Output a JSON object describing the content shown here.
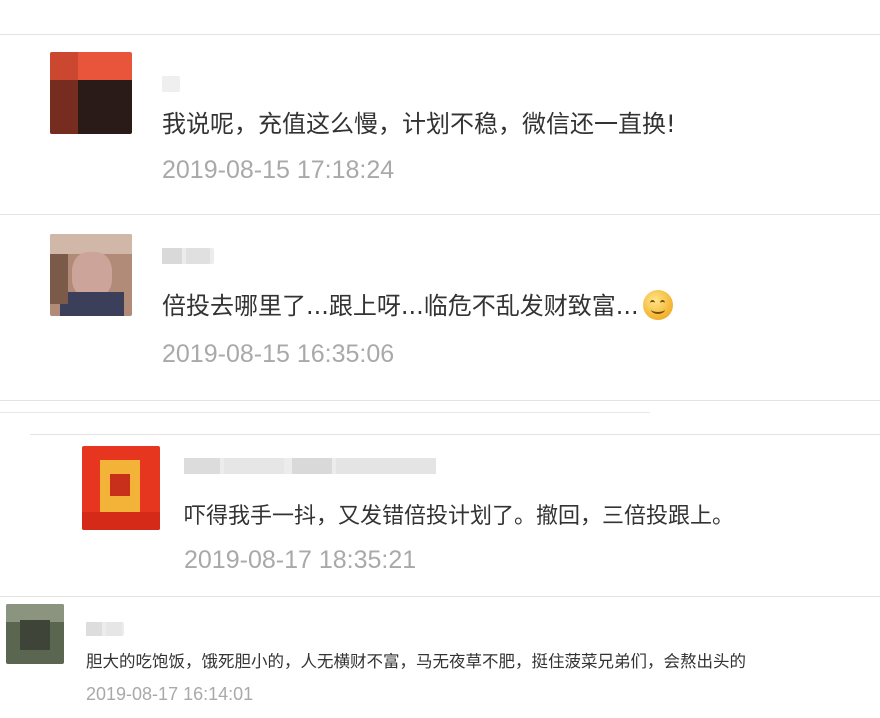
{
  "comments": [
    {
      "text": "我说呢，充值这么慢，计划不稳，微信还一直换!",
      "time": "2019-08-15 17:18:24"
    },
    {
      "text": "倍投去哪里了...跟上呀...临危不乱发财致富...",
      "emoji": "smiling-face-emoji",
      "time": "2019-08-15 16:35:06"
    },
    {
      "text": "吓得我手一抖，又发错倍投计划了。撤回，三倍投跟上。",
      "time": "2019-08-17 18:35:21"
    },
    {
      "text": "胆大的吃饱饭，饿死胆小的，人无横财不富，马无夜草不肥，挺住菠菜兄弟们，会熬出头的",
      "time": "2019-08-17 16:14:01"
    }
  ],
  "colors": {
    "text": "#333333",
    "timestamp": "#a9a9a9",
    "divider": "#e3e3e3"
  }
}
